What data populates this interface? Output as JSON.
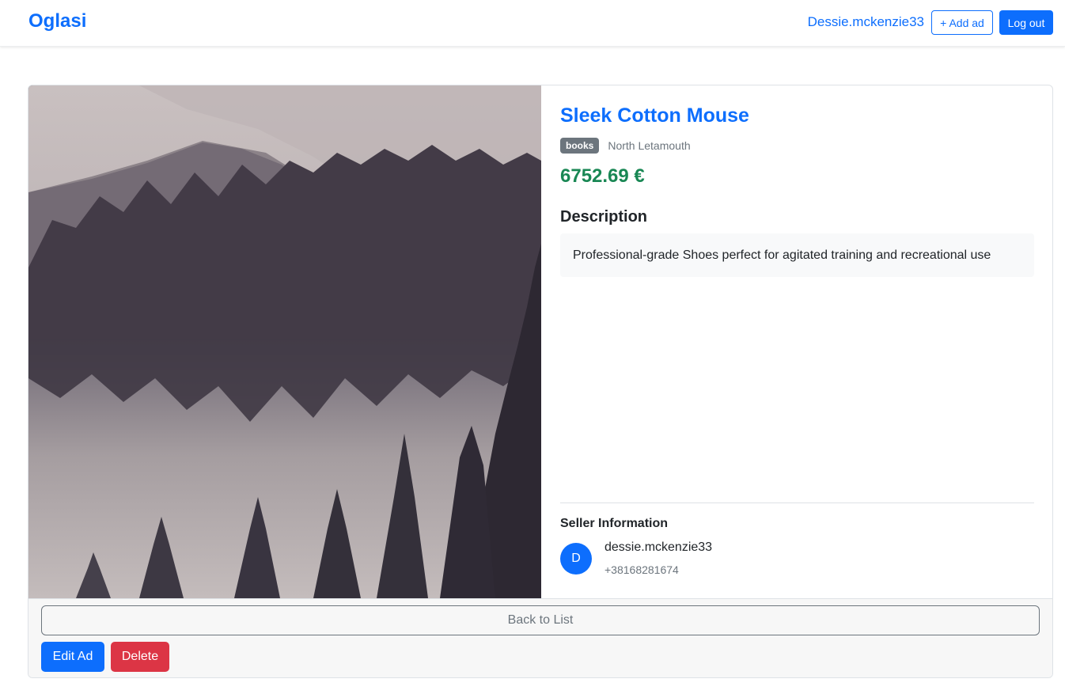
{
  "navbar": {
    "brand": "Oglasi",
    "username": "Dessie.mckenzie33",
    "add_ad_label": "+ Add ad",
    "logout_label": "Log out"
  },
  "ad": {
    "image_alt": "Forest lake landscape photo",
    "title": "Sleek Cotton Mouse",
    "category": "books",
    "location": "North Letamouth",
    "price": "6752.69 €",
    "description_heading": "Description",
    "description": "Professional-grade Shoes perfect for agitated training and recreational use"
  },
  "seller": {
    "heading": "Seller Information",
    "avatar_initial": "D",
    "username": "dessie.mckenzie33",
    "phone": "+38168281674"
  },
  "footer": {
    "back_label": "Back to List",
    "edit_label": "Edit Ad",
    "delete_label": "Delete"
  },
  "colors": {
    "primary": "#0d6efd",
    "success": "#198754",
    "danger": "#dc3545",
    "secondary": "#6c757d"
  }
}
